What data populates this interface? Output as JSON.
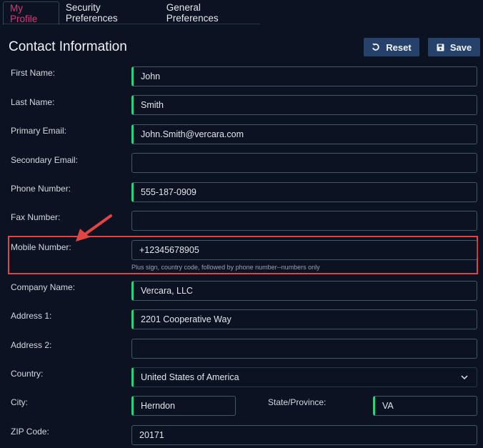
{
  "tabs": [
    {
      "label": "My Profile",
      "active": true
    },
    {
      "label": "Security Preferences",
      "active": false
    },
    {
      "label": "General Preferences",
      "active": false
    }
  ],
  "header": {
    "title": "Contact Information",
    "reset_label": "Reset",
    "save_label": "Save"
  },
  "form": {
    "first_name": {
      "label": "First Name:",
      "value": "John"
    },
    "last_name": {
      "label": "Last Name:",
      "value": "Smith"
    },
    "primary_email": {
      "label": "Primary Email:",
      "value": "John.Smith@vercara.com"
    },
    "secondary_email": {
      "label": "Secondary Email:",
      "value": ""
    },
    "phone_number": {
      "label": "Phone Number:",
      "value": "555-187-0909"
    },
    "fax_number": {
      "label": "Fax Number:",
      "value": ""
    },
    "mobile_number": {
      "label": "Mobile Number:",
      "value": "+12345678905",
      "hint": "Plus sign, country code, followed by phone number--numbers only"
    },
    "company_name": {
      "label": "Company Name:",
      "value": "Vercara, LLC"
    },
    "address1": {
      "label": "Address 1:",
      "value": "2201 Cooperative Way"
    },
    "address2": {
      "label": "Address 2:",
      "value": ""
    },
    "country": {
      "label": "Country:",
      "value": "United States of America"
    },
    "city": {
      "label": "City:",
      "value": "Herndon"
    },
    "state": {
      "label": "State/Province:",
      "value": "VA"
    },
    "zip": {
      "label": "ZIP Code:",
      "value": "20171"
    }
  },
  "colors": {
    "background": "#0b1322",
    "active_tab": "#e0357a",
    "required_marker": "#2dd37a",
    "button": "#26426a",
    "highlight": "#e04543"
  }
}
